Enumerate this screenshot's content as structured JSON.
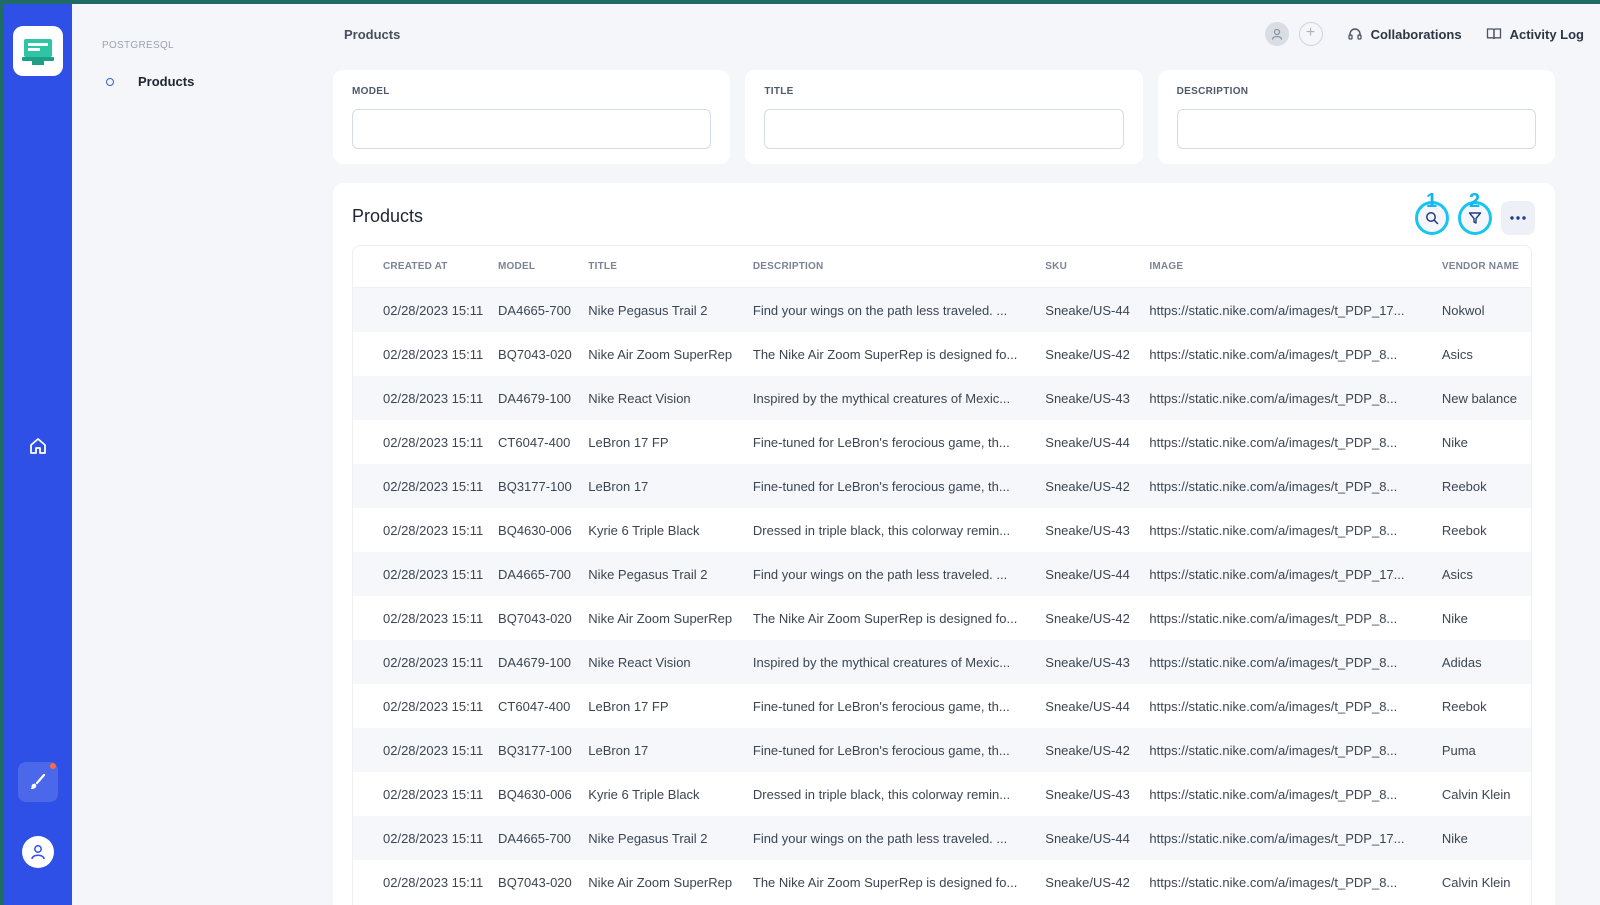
{
  "sidebar": {
    "group_label": "POSTGRESQL",
    "items": [
      {
        "label": "Products"
      }
    ]
  },
  "header": {
    "title": "Products",
    "collaborations_label": "Collaborations",
    "activity_log_label": "Activity Log"
  },
  "filters": [
    {
      "label": "MODEL",
      "value": ""
    },
    {
      "label": "TITLE",
      "value": ""
    },
    {
      "label": "DESCRIPTION",
      "value": ""
    }
  ],
  "panel": {
    "title": "Products",
    "markers": [
      "1",
      "2"
    ],
    "columns": [
      "CREATED AT",
      "MODEL",
      "TITLE",
      "DESCRIPTION",
      "SKU",
      "IMAGE",
      "VENDOR NAME"
    ],
    "rows": [
      [
        "02/28/2023 15:11",
        "DA4665-700",
        "Nike Pegasus Trail 2",
        "Find your wings on the path less traveled. ...",
        "Sneake/US-44",
        "https://static.nike.com/a/images/t_PDP_17...",
        "Nokwol"
      ],
      [
        "02/28/2023 15:11",
        "BQ7043-020",
        "Nike Air Zoom SuperRep",
        "The Nike Air Zoom SuperRep is designed fo...",
        "Sneake/US-42",
        "https://static.nike.com/a/images/t_PDP_8...",
        "Asics"
      ],
      [
        "02/28/2023 15:11",
        "DA4679-100",
        "Nike React Vision",
        "Inspired by the mythical creatures of Mexic...",
        "Sneake/US-43",
        "https://static.nike.com/a/images/t_PDP_8...",
        "New balance"
      ],
      [
        "02/28/2023 15:11",
        "CT6047-400",
        "LeBron 17 FP",
        "Fine-tuned for LeBron's ferocious game, th...",
        "Sneake/US-44",
        "https://static.nike.com/a/images/t_PDP_8...",
        "Nike"
      ],
      [
        "02/28/2023 15:11",
        "BQ3177-100",
        "LeBron 17",
        "Fine-tuned for LeBron's ferocious game, th...",
        "Sneake/US-42",
        "https://static.nike.com/a/images/t_PDP_8...",
        "Reebok"
      ],
      [
        "02/28/2023 15:11",
        "BQ4630-006",
        "Kyrie 6 Triple Black",
        "Dressed in triple black, this colorway remin...",
        "Sneake/US-43",
        "https://static.nike.com/a/images/t_PDP_8...",
        "Reebok"
      ],
      [
        "02/28/2023 15:11",
        "DA4665-700",
        "Nike Pegasus Trail 2",
        "Find your wings on the path less traveled. ...",
        "Sneake/US-44",
        "https://static.nike.com/a/images/t_PDP_17...",
        "Asics"
      ],
      [
        "02/28/2023 15:11",
        "BQ7043-020",
        "Nike Air Zoom SuperRep",
        "The Nike Air Zoom SuperRep is designed fo...",
        "Sneake/US-42",
        "https://static.nike.com/a/images/t_PDP_8...",
        "Nike"
      ],
      [
        "02/28/2023 15:11",
        "DA4679-100",
        "Nike React Vision",
        "Inspired by the mythical creatures of Mexic...",
        "Sneake/US-43",
        "https://static.nike.com/a/images/t_PDP_8...",
        "Adidas"
      ],
      [
        "02/28/2023 15:11",
        "CT6047-400",
        "LeBron 17 FP",
        "Fine-tuned for LeBron's ferocious game, th...",
        "Sneake/US-44",
        "https://static.nike.com/a/images/t_PDP_8...",
        "Reebok"
      ],
      [
        "02/28/2023 15:11",
        "BQ3177-100",
        "LeBron 17",
        "Fine-tuned for LeBron's ferocious game, th...",
        "Sneake/US-42",
        "https://static.nike.com/a/images/t_PDP_8...",
        "Puma"
      ],
      [
        "02/28/2023 15:11",
        "BQ4630-006",
        "Kyrie 6 Triple Black",
        "Dressed in triple black, this colorway remin...",
        "Sneake/US-43",
        "https://static.nike.com/a/images/t_PDP_8...",
        "Calvin Klein"
      ],
      [
        "02/28/2023 15:11",
        "DA4665-700",
        "Nike Pegasus Trail 2",
        "Find your wings on the path less traveled. ...",
        "Sneake/US-44",
        "https://static.nike.com/a/images/t_PDP_17...",
        "Nike"
      ],
      [
        "02/28/2023 15:11",
        "BQ7043-020",
        "Nike Air Zoom SuperRep",
        "The Nike Air Zoom SuperRep is designed fo...",
        "Sneake/US-42",
        "https://static.nike.com/a/images/t_PDP_8...",
        "Calvin Klein"
      ]
    ]
  },
  "icons": {
    "logo": "app-logo-icon",
    "home": "home-icon",
    "brush": "brush-icon",
    "user": "user-icon",
    "search": "search-icon",
    "filter": "filter-icon",
    "more": "more-icon",
    "collaborations": "headset-icon",
    "activity_log": "book-icon"
  },
  "colors": {
    "rail": "#2e50e6",
    "highlight": "#18c4f0",
    "notification": "#ff6b3d"
  }
}
